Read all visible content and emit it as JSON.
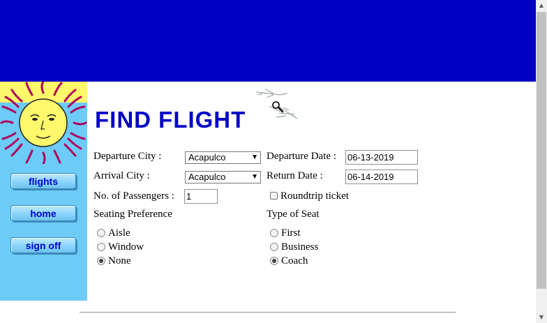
{
  "page": {
    "title": "FIND FLIGHT"
  },
  "nav": {
    "flights": "flights",
    "home": "home",
    "sign_off": "sign off"
  },
  "form": {
    "departure_city": {
      "label": "Departure City :",
      "value": "Acapulco"
    },
    "arrival_city": {
      "label": "Arrival City :",
      "value": "Acapulco"
    },
    "departure_date": {
      "label": "Departure Date :",
      "value": "06-13-2019"
    },
    "return_date": {
      "label": "Return Date :",
      "value": "06-14-2019"
    },
    "passengers": {
      "label": "No. of Passengers :",
      "value": "1"
    },
    "roundtrip": {
      "label": "Roundtrip ticket",
      "checked": false
    },
    "seating_preference": {
      "label": "Seating Preference",
      "options": [
        "Aisle",
        "Window",
        "None"
      ],
      "selected": "None"
    },
    "seat_type": {
      "label": "Type of Seat",
      "options": [
        "First",
        "Business",
        "Coach"
      ],
      "selected": "Coach"
    }
  },
  "icons": {
    "sun": "sun-logo-icon",
    "plane": "airplane-icon",
    "cursor": "magnifier-cursor-icon"
  },
  "colors": {
    "banner": "#0000c4",
    "sidebar": "#6dcbf7",
    "title": "#0000c4",
    "button_text": "#0000cc"
  }
}
